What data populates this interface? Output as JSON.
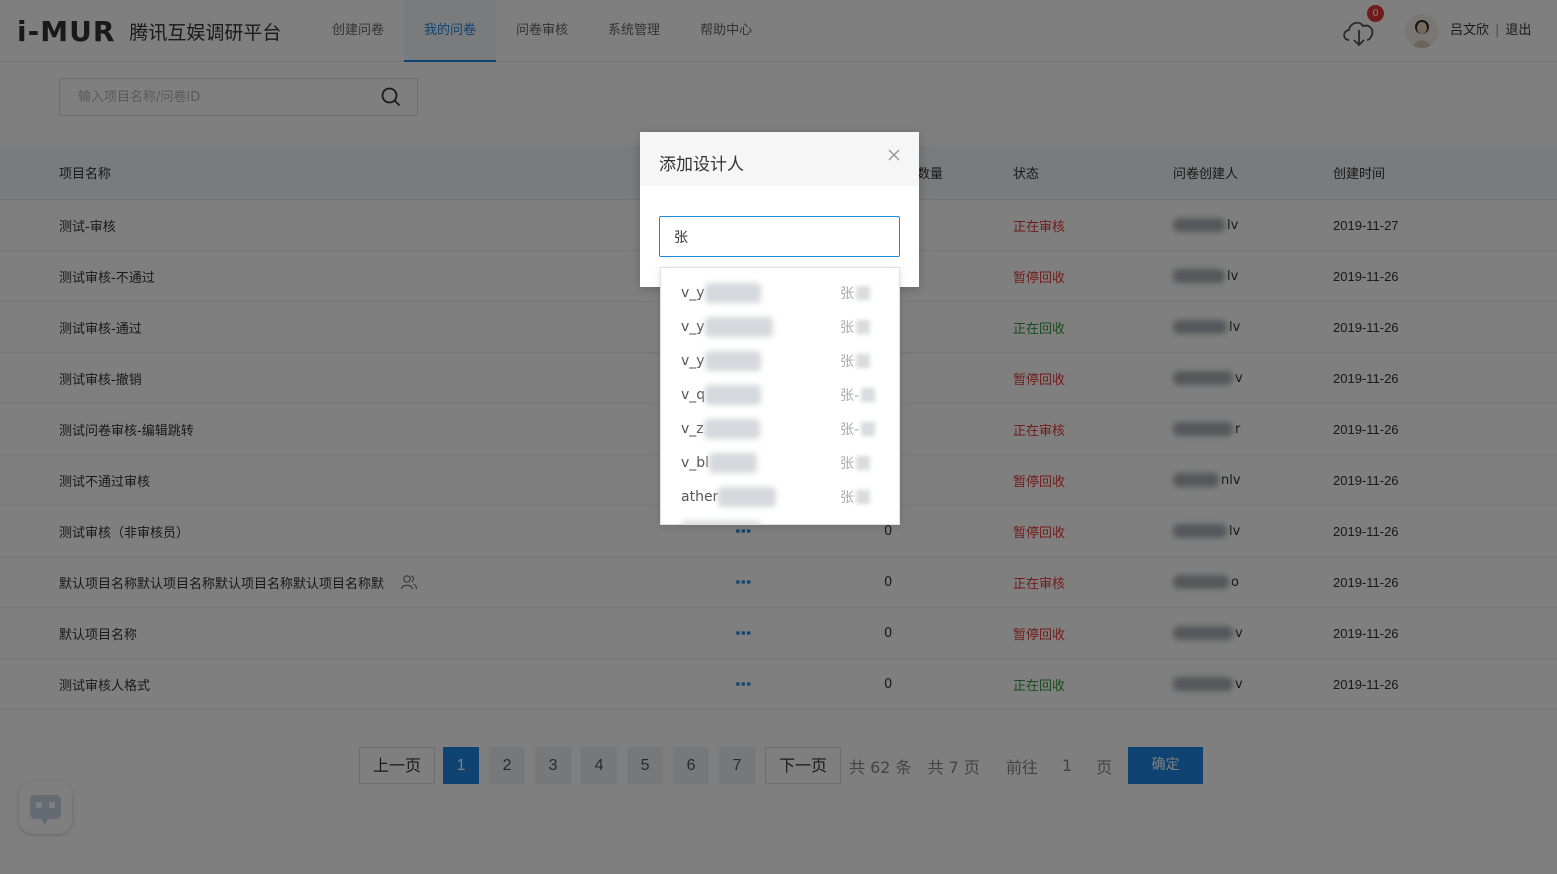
{
  "header": {
    "logo_mark": "i-MUR",
    "platform_name": "腾讯互娱调研平台",
    "nav": [
      {
        "label": "创建问卷",
        "active": false
      },
      {
        "label": "我的问卷",
        "active": true
      },
      {
        "label": "问卷审核",
        "active": false
      },
      {
        "label": "系统管理",
        "active": false
      },
      {
        "label": "帮助中心",
        "active": false
      }
    ],
    "download_badge": "0",
    "user_name": "吕文欣",
    "separator": "|",
    "logout": "退出"
  },
  "search": {
    "placeholder": "输入项目名称/问卷ID"
  },
  "table": {
    "headers": {
      "name": "项目名称",
      "count": "数量",
      "status": "状态",
      "creator": "问卷创建人",
      "time": "创建时间"
    },
    "rows": [
      {
        "name": "测试-审核",
        "count": "",
        "status": "正在审核",
        "status_color": "red",
        "creator_suffix": "lv",
        "time": "2019-11-27"
      },
      {
        "name": "测试审核-不通过",
        "count": "",
        "status": "暂停回收",
        "status_color": "red",
        "creator_suffix": "lv",
        "time": "2019-11-26"
      },
      {
        "name": "测试审核-通过",
        "count": "",
        "status": "正在回收",
        "status_color": "green",
        "creator_suffix": "lv",
        "time": "2019-11-26"
      },
      {
        "name": "测试审核-撤销",
        "count": "",
        "status": "暂停回收",
        "status_color": "red",
        "creator_suffix": "v",
        "time": "2019-11-26"
      },
      {
        "name": "测试问卷审核-编辑跳转",
        "count": "",
        "status": "正在审核",
        "status_color": "red",
        "creator_suffix": "r",
        "time": "2019-11-26"
      },
      {
        "name": "测试不通过审核",
        "count": "",
        "status": "暂停回收",
        "status_color": "red",
        "creator_suffix": "nlv",
        "time": "2019-11-26"
      },
      {
        "name": "测试审核（非审核员）",
        "count": "0",
        "status": "暂停回收",
        "status_color": "red",
        "creator_suffix": "lv",
        "time": "2019-11-26"
      },
      {
        "name": "默认项目名称默认项目名称默认项目名称默认项目名称默",
        "count": "0",
        "status": "正在审核",
        "status_color": "red",
        "creator_suffix": "o",
        "time": "2019-11-26",
        "group_icon": true
      },
      {
        "name": "默认项目名称",
        "count": "0",
        "status": "暂停回收",
        "status_color": "red",
        "creator_suffix": "v",
        "time": "2019-11-26"
      },
      {
        "name": "测试审核人格式",
        "count": "0",
        "status": "正在回收",
        "status_color": "green",
        "creator_suffix": "v",
        "time": "2019-11-26"
      }
    ]
  },
  "pagination": {
    "prev": "上一页",
    "pages": [
      "1",
      "2",
      "3",
      "4",
      "5",
      "6",
      "7"
    ],
    "current": "1",
    "next": "下一页",
    "total_items": "共 62 条",
    "total_pages": "共 7 页",
    "goto_label": "前往",
    "goto_value": "1",
    "page_unit": "页",
    "confirm": "确定"
  },
  "modal": {
    "title": "添加设计人",
    "input_value": "张",
    "options": [
      {
        "id_prefix": "v_y",
        "name_prefix": "张"
      },
      {
        "id_prefix": "v_y",
        "name_prefix": "张"
      },
      {
        "id_prefix": "v_y",
        "name_prefix": "张"
      },
      {
        "id_prefix": "v_q",
        "name_prefix": "张-"
      },
      {
        "id_prefix": "v_z",
        "name_prefix": "张-"
      },
      {
        "id_prefix": "v_bl",
        "name_prefix": "张"
      },
      {
        "id_prefix": "ather",
        "name_prefix": "张"
      }
    ]
  },
  "colors": {
    "accent": "#1e88e5",
    "status_red": "#e53935",
    "status_green": "#2e9b3a"
  }
}
